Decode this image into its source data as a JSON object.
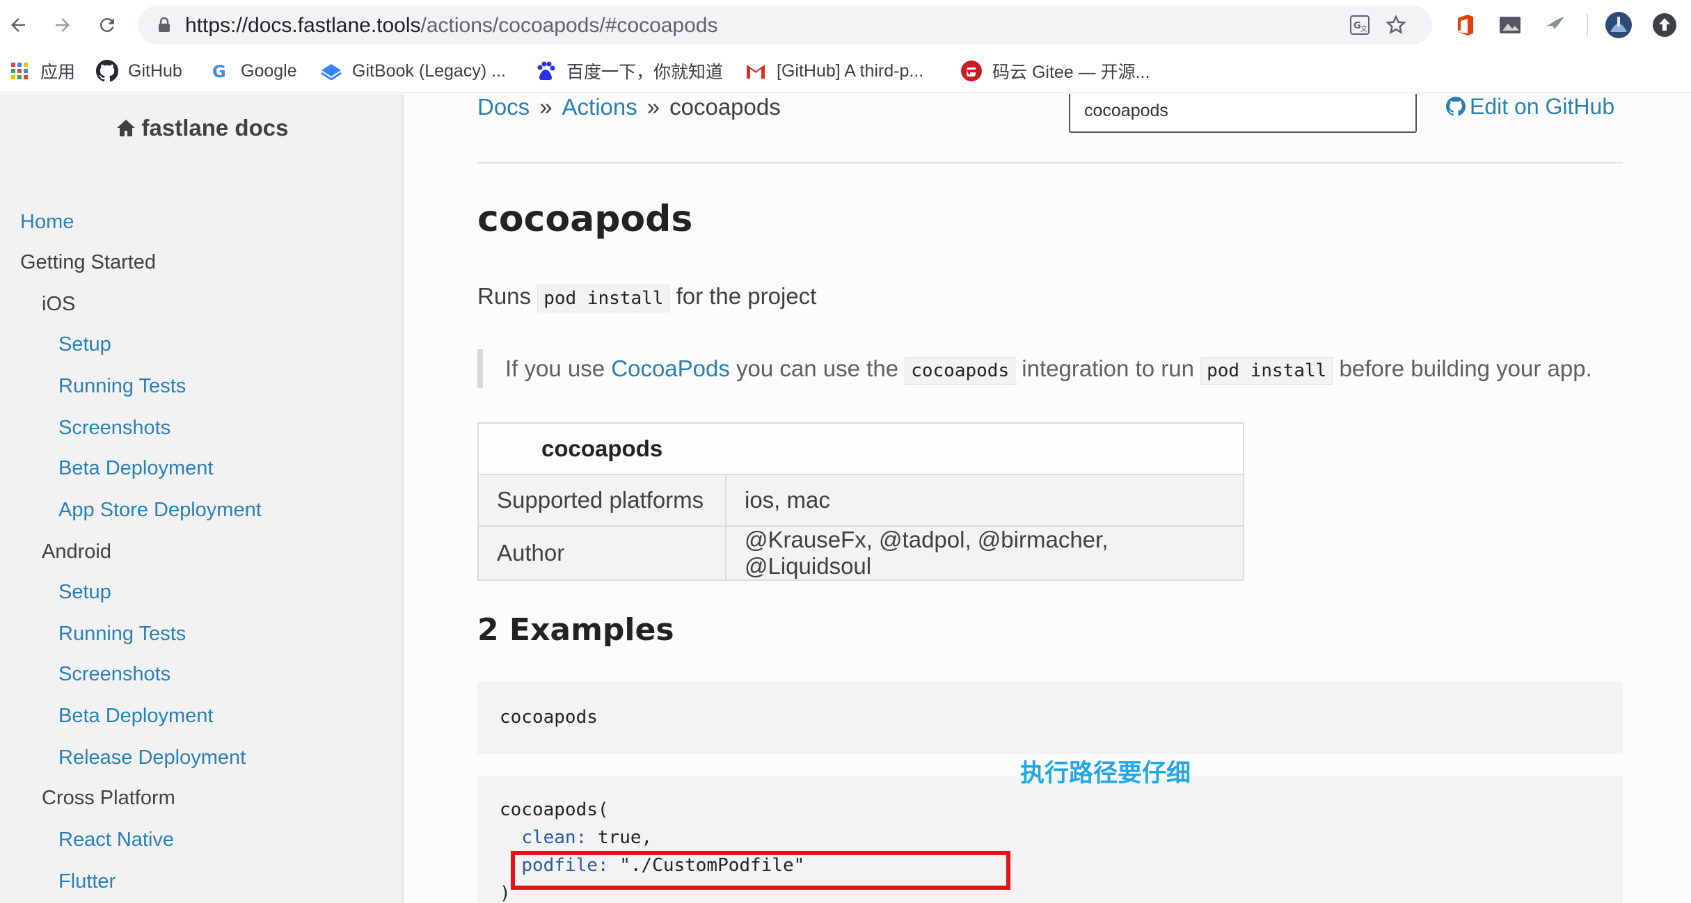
{
  "browser": {
    "url_host": "https://docs.fastlane.tools",
    "url_path": "/actions/cocoapods/#cocoapods",
    "bookmarks": [
      {
        "label": "应用",
        "icon": "apps-grid-icon"
      },
      {
        "label": "GitHub",
        "icon": "github-icon"
      },
      {
        "label": "Google",
        "icon": "google-icon"
      },
      {
        "label": "GitBook (Legacy) ...",
        "icon": "gitbook-icon"
      },
      {
        "label": "百度一下，你就知道",
        "icon": "baidu-icon"
      },
      {
        "label": "[GitHub] A third-p...",
        "icon": "gmail-icon"
      },
      {
        "label": "码云 Gitee — 开源...",
        "icon": "gitee-icon"
      }
    ]
  },
  "sidebar": {
    "brand": "fastlane docs",
    "items": [
      {
        "label": "Home",
        "type": "link"
      },
      {
        "label": "Getting Started",
        "type": "head"
      },
      {
        "label": "iOS",
        "type": "head"
      },
      {
        "label": "Setup",
        "type": "link"
      },
      {
        "label": "Running Tests",
        "type": "link"
      },
      {
        "label": "Screenshots",
        "type": "link"
      },
      {
        "label": "Beta Deployment",
        "type": "link"
      },
      {
        "label": "App Store Deployment",
        "type": "link"
      },
      {
        "label": "Android",
        "type": "head"
      },
      {
        "label": "Setup",
        "type": "link"
      },
      {
        "label": "Running Tests",
        "type": "link"
      },
      {
        "label": "Screenshots",
        "type": "link"
      },
      {
        "label": "Beta Deployment",
        "type": "link"
      },
      {
        "label": "Release Deployment",
        "type": "link"
      },
      {
        "label": "Cross Platform",
        "type": "head"
      },
      {
        "label": "React Native",
        "type": "link"
      },
      {
        "label": "Flutter",
        "type": "link"
      }
    ]
  },
  "breadcrumb": {
    "docs": "Docs",
    "sep": "»",
    "actions": "Actions",
    "current": "cocoapods"
  },
  "search": {
    "value": "cocoapods"
  },
  "edit_link": "Edit on GitHub",
  "content": {
    "title": "cocoapods",
    "runs_pre": "Runs",
    "runs_code": "pod install",
    "runs_post": "for the project",
    "quote": {
      "p1": "If you use",
      "link": "CocoaPods",
      "p2": "you can use the",
      "code1": "cocoapods",
      "p3": "integration to run",
      "code2": "pod install",
      "p4": "before building your app."
    },
    "table": {
      "header": "cocoapods",
      "rows": [
        {
          "key": "Supported platforms",
          "value": "ios, mac"
        },
        {
          "key": "Author",
          "value": "@KrauseFx, @tadpol, @birmacher, @Liquidsoul"
        }
      ]
    },
    "examples_title": "2 Examples",
    "example1": "cocoapods",
    "example2": {
      "line1": "cocoapods(",
      "clean_key": "clean:",
      "clean_val": "true,",
      "podfile_key": "podfile:",
      "podfile_val": "\"./CustomPodfile\"",
      "close": ")"
    },
    "annotation": "执行路径要仔细"
  },
  "colors": {
    "link": "#2980b9",
    "annotation": "#21a7e6",
    "highlight_box": "#e5121c"
  }
}
